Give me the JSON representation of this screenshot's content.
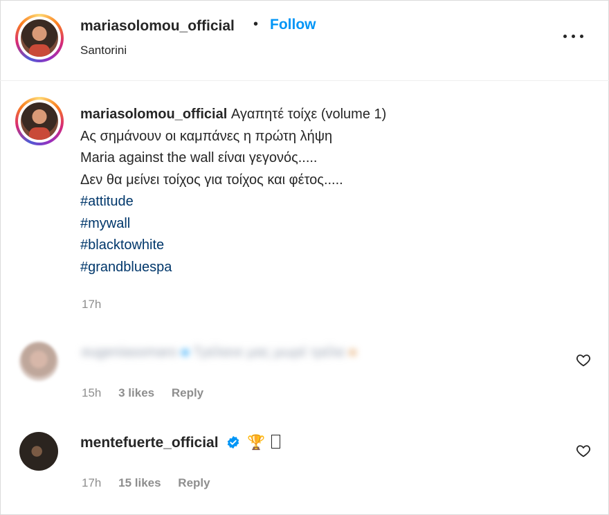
{
  "header": {
    "username": "mariasolomou_official",
    "separator": "•",
    "follow_label": "Follow",
    "location": "Santorini"
  },
  "caption": {
    "username": "mariasolomou_official",
    "first_line": "Αγαπητέ τοίχε (volume 1)",
    "lines": [
      "Ας σημάνουν οι καμπάνες η πρώτη λήψη",
      "Maria against the wall είναι γεγονός.....",
      "Δεν θα μείνει τοίχος για τοίχος και φέτος....."
    ],
    "hashtags": [
      "#attitude",
      "#mywall",
      "#blacktowhite",
      "#grandbluespa"
    ],
    "time": "17h"
  },
  "comments": [
    {
      "username": "eugeniasomaro",
      "text": "Τρέλανε μας μωρέ τρέλα",
      "time": "15h",
      "likes": "3 likes",
      "reply_label": "Reply",
      "blurred": true
    },
    {
      "username": "mentefuerte_official",
      "emoji": "🏆",
      "time": "17h",
      "likes": "15 likes",
      "reply_label": "Reply",
      "verified": true
    }
  ],
  "colors": {
    "accent": "#0095f6",
    "hashtag": "#00376b",
    "muted": "#8e8e8e",
    "verified": "#0095f6"
  },
  "icons": {
    "more": "more-options-icon",
    "heart": "heart-icon",
    "verified": "verified-badge-icon"
  }
}
